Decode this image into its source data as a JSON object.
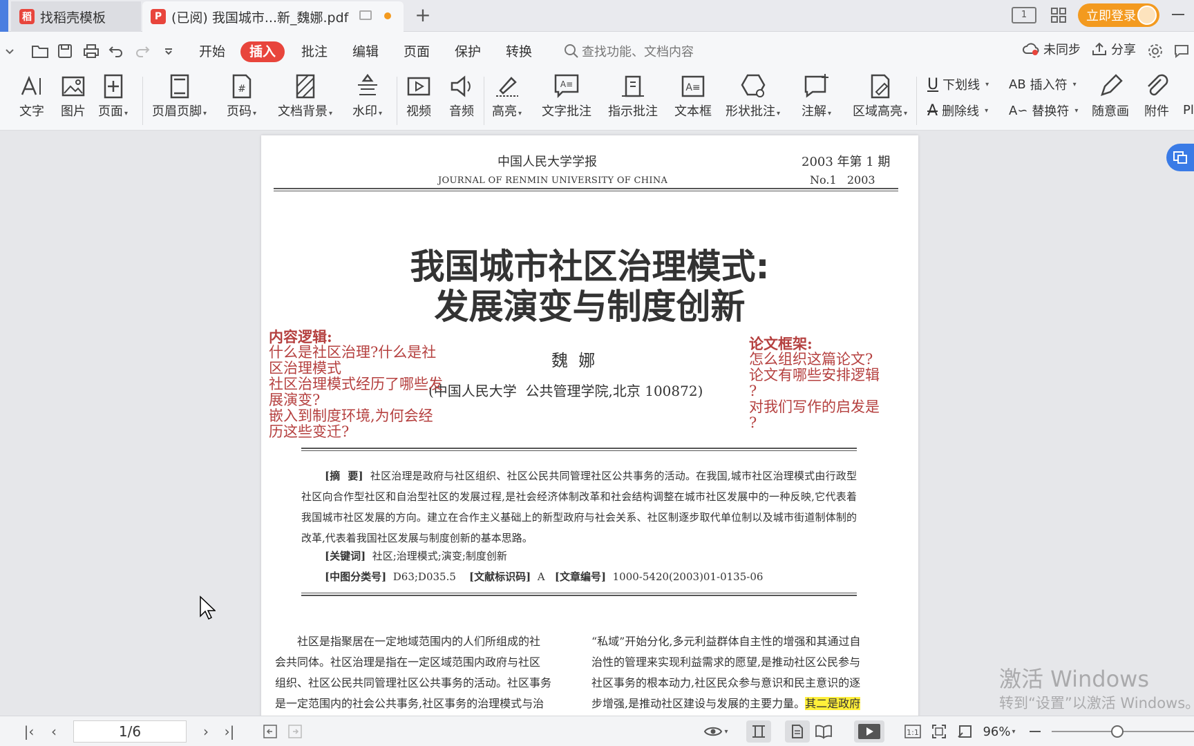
{
  "tabs": [
    {
      "label": "找稻壳模板",
      "icon": "docer-logo-icon"
    },
    {
      "label": "(已阅) 我国城市...新_魏娜.pdf",
      "icon": "pdf-icon"
    }
  ],
  "titlebar": {
    "login_label": "立即登录",
    "new_tab": "+"
  },
  "menu": {
    "items": [
      "开始",
      "插入",
      "批注",
      "编辑",
      "页面",
      "保护",
      "转换"
    ],
    "active": "插入",
    "search_placeholder": "查找功能、文档内容",
    "unsync_label": "未同步",
    "share_label": "分享"
  },
  "ribbon": {
    "text": "文字",
    "image": "图片",
    "page": "页面",
    "header_footer": "页眉页脚",
    "page_number": "页码",
    "doc_background": "文档背景",
    "watermark": "水印",
    "video": "视频",
    "audio": "音频",
    "highlight": "高亮",
    "text_comment": "文字批注",
    "pointer_comment": "指示批注",
    "text_box": "文本框",
    "shape_comment": "形状批注",
    "annotation": "注解",
    "area_highlight": "区域高亮",
    "underline": "下划线",
    "strikethrough": "删除线",
    "insert_mark": "插入符",
    "replace_mark": "替换符",
    "freehand": "随意画",
    "attachment": "附件",
    "more": "Pl"
  },
  "document": {
    "journal_cn": "中国人民大学学报",
    "issue_cn": "2003 年第 1 期",
    "journal_en": "JOURNAL OF RENMIN UNIVERSITY OF CHINA",
    "issue_en": "No.1   2003",
    "title_line1": "我国城市社区治理模式:",
    "title_line2": "发展演变与制度创新",
    "author": "魏  娜",
    "affiliation": "(中国人民大学  公共管理学院,北京 100872)",
    "abstract_label": "[摘  要]",
    "abstract_text": "社区治理是政府与社区组织、社区公民共同管理社区公共事务的活动。在我国,城市社区治理模式由行政型社区向合作型社区和自治型社区的发展过程,是社会经济体制改革和社会结构调整在城市社区发展中的一种反映,它代表着我国城市社区发展的方向。建立在合作主义基础上的新型政府与社会关系、社区制逐步取代单位制以及城市街道制体制的改革,代表着我国社区发展与制度创新的基本思路。",
    "keywords_label": "[关键词]",
    "keywords_text": "社区;治理模式;演变;制度创新",
    "classno_label": "[中图分类号]",
    "classno_text": "D63;D035.5",
    "doccode_label": "[文献标识码]",
    "doccode_text": "A",
    "articleno_label": "[文章编号]",
    "articleno_text": "1000-5420(2003)01-0135-06",
    "col1_lines": [
      "社区是指聚居在一定地域范围内的人们所组成的社",
      "会共同体。社区治理是指在一定区域范围内政府与社区",
      "组织、社区公民共同管理社区公共事务的活动。社区事务",
      "是一定范围内的社会公共事务,社区事务的治理模式与治"
    ],
    "col2_lines": [
      "“私域”开始分化,多元利益群体自主性的增强和其通过自",
      "治性的管理来实现利益需求的愿望,是推动社区公民参与",
      "社区事务的根本动力,社区民众参与意识和民主意识的逐"
    ],
    "col2_last_plain": "步增强,是推动社区建设与发展的主要力量。",
    "col2_last_highlight": "其二是政府"
  },
  "annotations": {
    "left": {
      "title": "内容逻辑:",
      "lines": [
        "什么是社区治理?什么是社",
        "区治理模式",
        "社区治理模式经历了哪些发",
        "展演变?",
        "嵌入到制度环境,为何会经",
        "历这些变迁?"
      ]
    },
    "right": {
      "title": "论文框架:",
      "lines": [
        "怎么组织这篇论文?",
        "论文有哪些安排逻辑",
        "?",
        "对我们写作的启发是",
        "?"
      ]
    }
  },
  "watermark": {
    "line1": "激活 Windows",
    "line2": "转到“设置”以激活 Windows。"
  },
  "statusbar": {
    "page_indicator": "1/6",
    "zoom": "96%"
  },
  "colors": {
    "accent": "#e8453c",
    "login_bg": "#f39a1f",
    "annotation": "#b5403f",
    "highlight": "#ffef3a"
  }
}
